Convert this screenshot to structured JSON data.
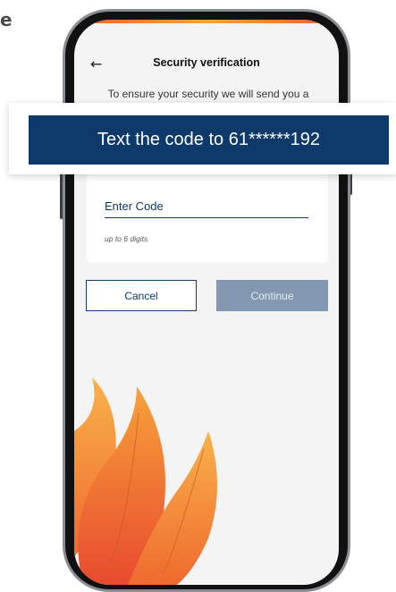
{
  "page": {
    "corner_letter": "e"
  },
  "header": {
    "back_icon": "arrow-left-icon",
    "title": "Security verification"
  },
  "intro": {
    "text": "To ensure your security we will send you a"
  },
  "code_field": {
    "placeholder": "Enter Code",
    "value": "",
    "hint": "up to 6 digits"
  },
  "actions": {
    "cancel_label": "Cancel",
    "continue_label": "Continue"
  },
  "banner": {
    "text": "Text the code to 61******192"
  },
  "colors": {
    "primary": "#0d3a6b",
    "disabled": "#8198b0",
    "background": "#f4f4f4",
    "flame_orange": "#f5a23a",
    "flame_red": "#e8622b"
  },
  "decor": {
    "flame_icon": "flame-leaves-icon"
  }
}
